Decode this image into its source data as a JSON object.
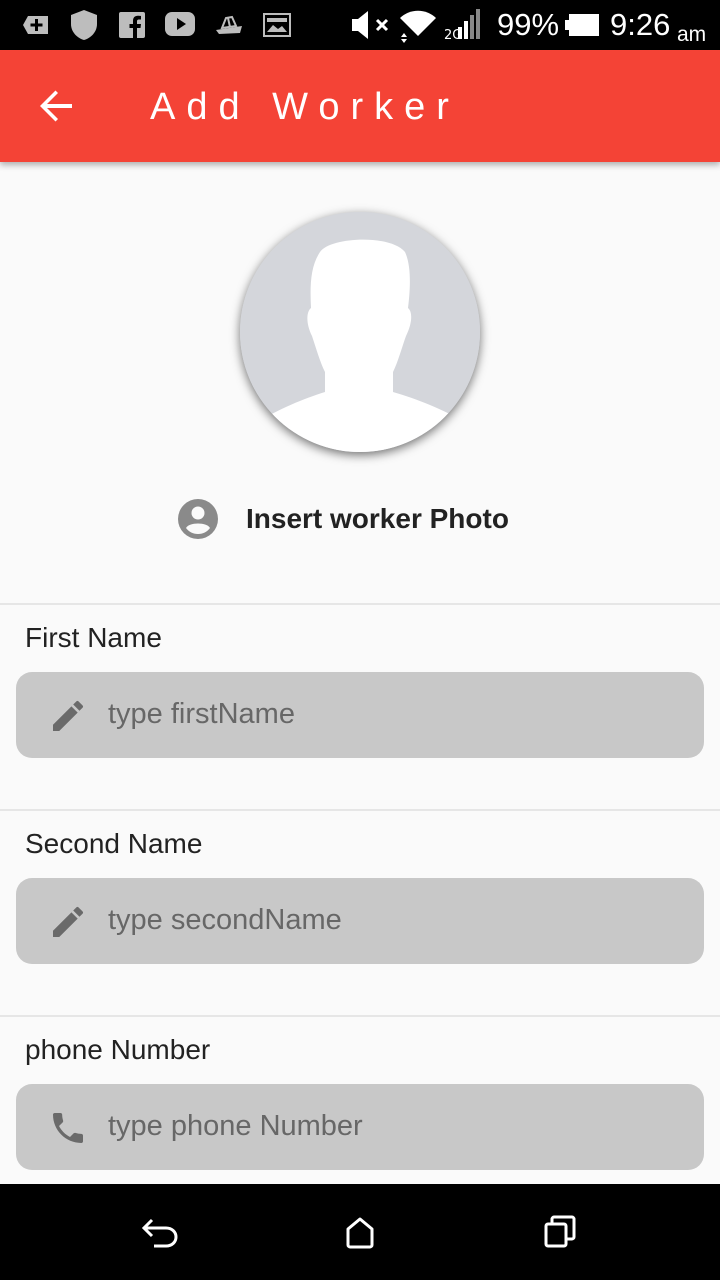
{
  "status_bar": {
    "battery_percent": "99%",
    "time": "9:26",
    "ampm": "am",
    "icons": [
      "battery-saver-icon",
      "shield-icon",
      "facebook-icon",
      "youtube-icon",
      "ship-icon",
      "image-icon",
      "muted-icon",
      "wifi-icon",
      "signal-icon",
      "battery-icon"
    ]
  },
  "app_bar": {
    "title": "Add Worker",
    "color": "#f44336"
  },
  "photo": {
    "label": "Insert worker Photo"
  },
  "fields": [
    {
      "label": "First Name",
      "placeholder": "type firstName",
      "icon": "pencil-icon"
    },
    {
      "label": "Second Name",
      "placeholder": "type secondName",
      "icon": "pencil-icon"
    },
    {
      "label": "phone Number",
      "placeholder": "type phone Number",
      "icon": "phone-icon"
    }
  ],
  "nav_bar": {
    "icons": [
      "back-icon",
      "home-icon",
      "recents-icon"
    ]
  }
}
